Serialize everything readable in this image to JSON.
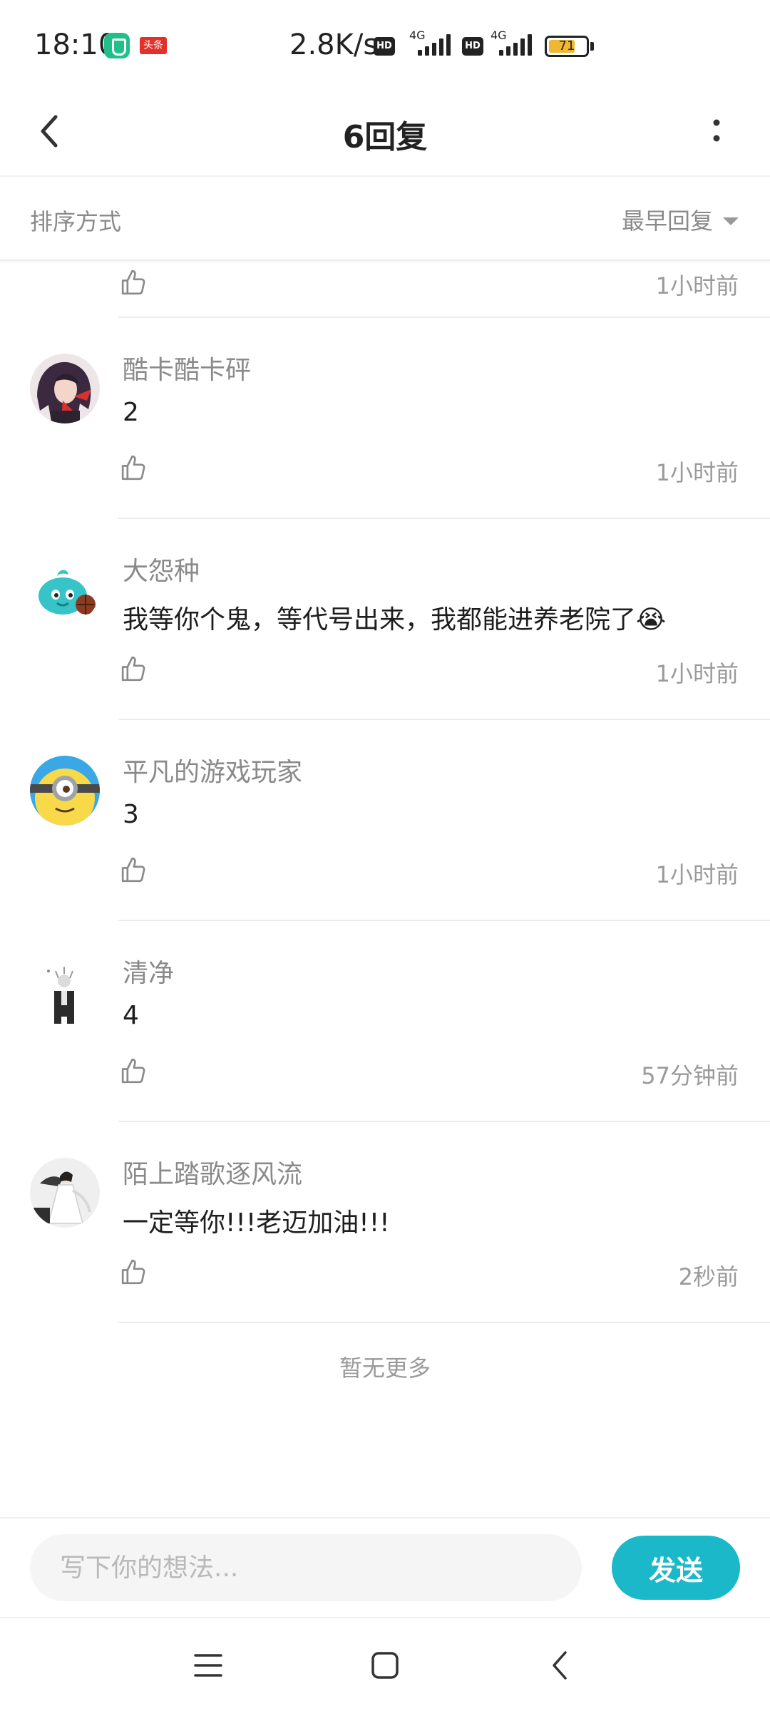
{
  "status_bar": {
    "time": "18:10",
    "toutiao_badge": "头条",
    "net_speed": "2.8K/s",
    "hd_label": "HD",
    "net_type": "4G",
    "battery": "71",
    "battery_level_pct": 71
  },
  "header": {
    "title": "6回复"
  },
  "sort": {
    "label": "排序方式",
    "selected": "最早回复"
  },
  "partial_item": {
    "time": "1小时前"
  },
  "comments": [
    {
      "username": "酷卡酷卡砰",
      "content": "2",
      "time": "1小时前"
    },
    {
      "username": "大怨种",
      "content": "我等你个鬼，等代号出来，我都能进养老院了😭",
      "time": "1小时前"
    },
    {
      "username": "平凡的游戏玩家",
      "content": "3",
      "time": "1小时前"
    },
    {
      "username": "清净",
      "content": "4",
      "time": "57分钟前"
    },
    {
      "username": "陌上踏歌逐风流",
      "content": "一定等你!!!老迈加油!!!",
      "time": "2秒前"
    }
  ],
  "footer_note": "暂无更多",
  "composer": {
    "placeholder": "写下你的想法...",
    "send_label": "发送"
  },
  "colors": {
    "accent": "#1ab8c9",
    "secondary_text": "#8a8a8a"
  },
  "icons": {
    "back": "chevron-left-icon",
    "more": "more-vertical-icon",
    "like": "thumbs-up-icon",
    "nav_menu": "menu-icon",
    "nav_home": "home-square-icon",
    "nav_back": "back-icon"
  }
}
